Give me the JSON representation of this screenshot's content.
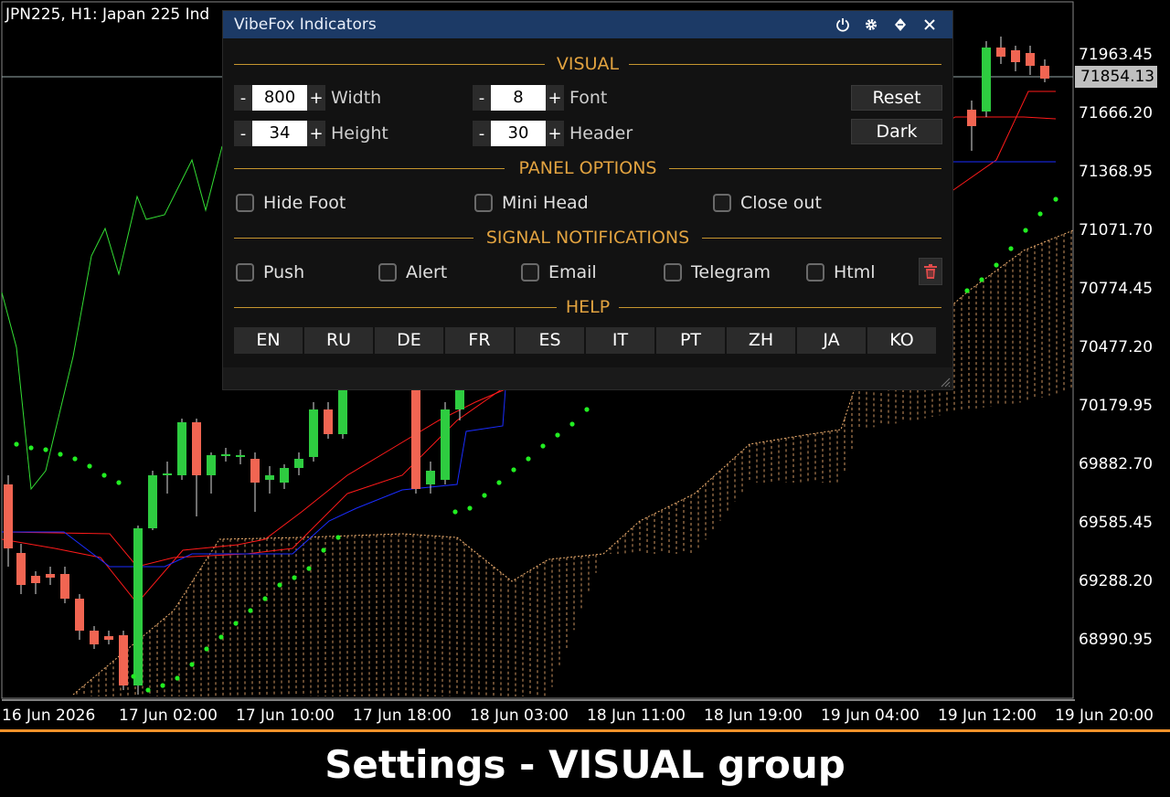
{
  "chart": {
    "title": "JPN225, H1:  Japan 225 Ind",
    "price_axis": [
      "71963.45",
      "71666.20",
      "71368.95",
      "71071.70",
      "70774.45",
      "70477.20",
      "70179.95",
      "69882.70",
      "69585.45",
      "69288.20",
      "68990.95"
    ],
    "current_price": "71854.13",
    "time_axis": [
      "16 Jun 2026",
      "17 Jun 02:00",
      "17 Jun 10:00",
      "17 Jun 18:00",
      "18 Jun 03:00",
      "18 Jun 11:00",
      "18 Jun 19:00",
      "19 Jun 04:00",
      "19 Jun 12:00",
      "19 Jun 20:00"
    ],
    "colors": {
      "bull": "#2ecc40",
      "bear": "#f16552",
      "tenkan": "#ff1a1a",
      "kijun": "#1a2cff",
      "chikou": "#33dd33",
      "cloud": "#f0b070",
      "psar": "#22ee22"
    }
  },
  "panel": {
    "title": "VibeFox Indicators",
    "icons": [
      "power-icon",
      "gear-icon",
      "diamond-icon",
      "close-icon"
    ],
    "visual": {
      "heading": "VISUAL",
      "width": {
        "value": "800",
        "label": "Width"
      },
      "height": {
        "value": "34",
        "label": "Height"
      },
      "font": {
        "value": "8",
        "label": "Font"
      },
      "header": {
        "value": "30",
        "label": "Header"
      },
      "minus": "-",
      "plus": "+",
      "reset_label": "Reset",
      "dark_label": "Dark"
    },
    "panel_options": {
      "heading": "PANEL OPTIONS",
      "hide_foot": "Hide Foot",
      "mini_head": "Mini Head",
      "close_out": "Close out"
    },
    "notifications": {
      "heading": "SIGNAL NOTIFICATIONS",
      "push": "Push",
      "alert": "Alert",
      "email": "Email",
      "telegram": "Telegram",
      "html": "Html"
    },
    "help": {
      "heading": "HELP",
      "languages": [
        "EN",
        "RU",
        "DE",
        "FR",
        "ES",
        "IT",
        "PT",
        "ZH",
        "JA",
        "KO"
      ]
    }
  },
  "footer": {
    "caption": "Settings - VISUAL group"
  }
}
